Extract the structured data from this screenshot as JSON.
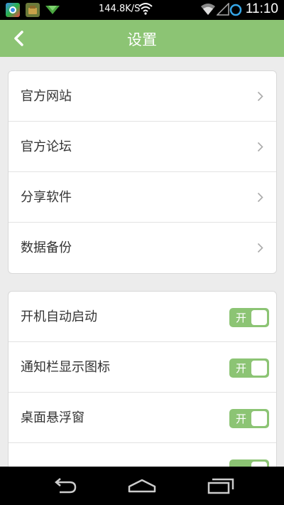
{
  "status_bar": {
    "net_speed": "144.8K/S",
    "time": "11:10",
    "icons": [
      "browser-app-icon",
      "android-app-icon",
      "download-icon",
      "wifi-icon",
      "signal-icon",
      "sync-icon"
    ]
  },
  "header": {
    "title": "设置",
    "back_icon": "chevron-left-icon",
    "color": "#8cc474"
  },
  "links": [
    {
      "label": "官方网站"
    },
    {
      "label": "官方论坛"
    },
    {
      "label": "分享软件"
    },
    {
      "label": "数据备份"
    }
  ],
  "toggles": [
    {
      "label": "开机自动启动",
      "state_label": "开",
      "on": true
    },
    {
      "label": "通知栏显示图标",
      "state_label": "开",
      "on": true
    },
    {
      "label": "桌面悬浮窗",
      "state_label": "开",
      "on": true
    },
    {
      "label": "",
      "state_label": "",
      "on": true
    }
  ],
  "nav_bar": {
    "icons": [
      "back-icon",
      "home-icon",
      "recent-apps-icon"
    ]
  }
}
